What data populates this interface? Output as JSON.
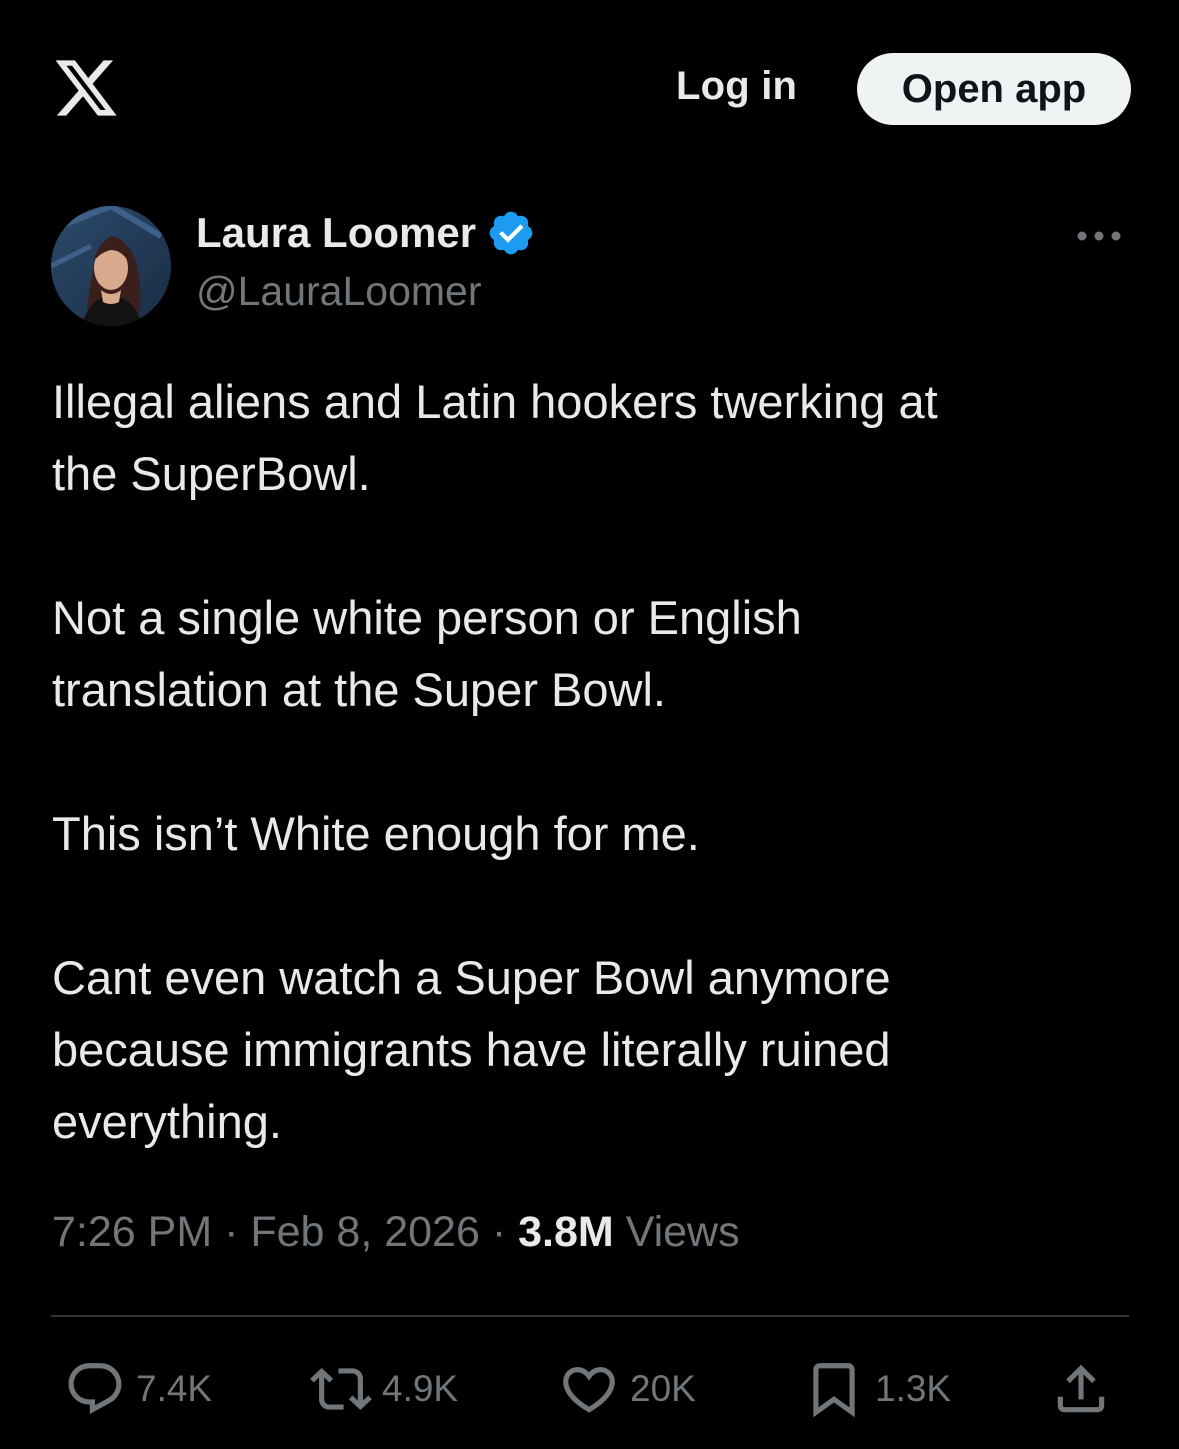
{
  "header": {
    "login_label": "Log in",
    "open_app_label": "Open app"
  },
  "author": {
    "display_name": "Laura Loomer",
    "handle": "@LauraLoomer",
    "verified": true,
    "verified_color": "#1d9bf0"
  },
  "tweet": {
    "paragraphs": [
      "Illegal aliens and Latin hookers twerking at\nthe SuperBowl.",
      "Not a single white person or English\ntranslation at the Super Bowl.",
      "This isn’t White enough for me.",
      "Cant even watch a Super Bowl anymore\nbecause immigrants have literally ruined\neverything."
    ],
    "time": "7:26 PM",
    "separator": "·",
    "date": "Feb 8, 2026",
    "views_count": "3.8M",
    "views_label": "Views"
  },
  "actions": {
    "replies": "7.4K",
    "reposts": "4.9K",
    "likes": "20K",
    "bookmarks": "1.3K"
  },
  "icons": {
    "logo": "x-logo-icon",
    "more": "more-horizontal-icon",
    "reply": "reply-icon",
    "repost": "repost-icon",
    "like": "heart-icon",
    "bookmark": "bookmark-icon",
    "share": "share-icon"
  },
  "colors": {
    "background": "#000000",
    "text": "#e7e9ea",
    "secondary": "#71767b",
    "button_bg": "#eff3f4"
  }
}
